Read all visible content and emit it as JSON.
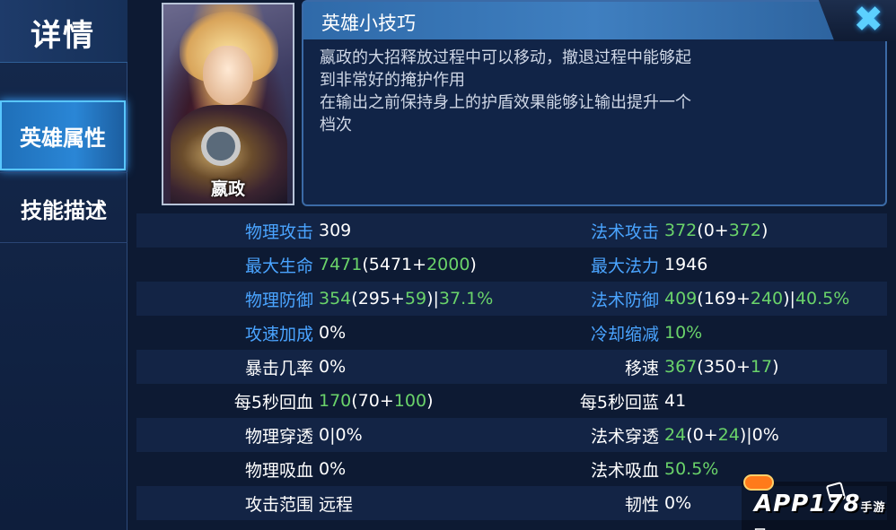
{
  "sidebar": {
    "title": "详情",
    "items": [
      {
        "label": "英雄属性",
        "active": true
      },
      {
        "label": "技能描述",
        "active": false
      }
    ]
  },
  "hero": {
    "name": "嬴政"
  },
  "tips": {
    "title": "英雄小技巧",
    "lines": [
      "嬴政的大招释放过程中可以移动，撤退过程中能够起",
      "到非常好的掩护作用",
      "在输出之前保持身上的护盾效果能够让输出提升一个",
      "档次"
    ],
    "close_icon": "close-icon"
  },
  "stats": {
    "left": [
      {
        "label": "物理攻击",
        "label_color": "blue",
        "value": "309"
      },
      {
        "label": "最大生命",
        "label_color": "blue",
        "value": "7471(5471+2000)"
      },
      {
        "label": "物理防御",
        "label_color": "blue",
        "value": "354(295+59)|37.1%"
      },
      {
        "label": "攻速加成",
        "label_color": "blue",
        "value": "0%"
      },
      {
        "label": "暴击几率",
        "label_color": "white",
        "value": "0%"
      },
      {
        "label": "每5秒回血",
        "label_color": "white",
        "value": "170(70+100)"
      },
      {
        "label": "物理穿透",
        "label_color": "white",
        "value": "0|0%"
      },
      {
        "label": "物理吸血",
        "label_color": "white",
        "value": "0%"
      },
      {
        "label": "攻击范围",
        "label_color": "white",
        "value": "远程"
      }
    ],
    "right": [
      {
        "label": "法术攻击",
        "label_color": "blue",
        "value": "372(0+372)"
      },
      {
        "label": "最大法力",
        "label_color": "blue",
        "value": "1946"
      },
      {
        "label": "法术防御",
        "label_color": "blue",
        "value": "409(169+240)|40.5%"
      },
      {
        "label": "冷却缩减",
        "label_color": "blue",
        "value": "10%"
      },
      {
        "label": "移速",
        "label_color": "white",
        "value": "367(350+17)"
      },
      {
        "label": "每5秒回蓝",
        "label_color": "white",
        "value": "41"
      },
      {
        "label": "法术穿透",
        "label_color": "white",
        "value": "24(0+24)|0%"
      },
      {
        "label": "法术吸血",
        "label_color": "white",
        "value": "50.5%"
      },
      {
        "label": "韧性",
        "label_color": "white",
        "value": "0%"
      }
    ]
  },
  "watermark": {
    "text": "APP178",
    "sub": "手游网"
  },
  "colors": {
    "label_blue": "#4aa4ff",
    "value_green": "#6ad36a",
    "accent": "#5cd0ff"
  }
}
